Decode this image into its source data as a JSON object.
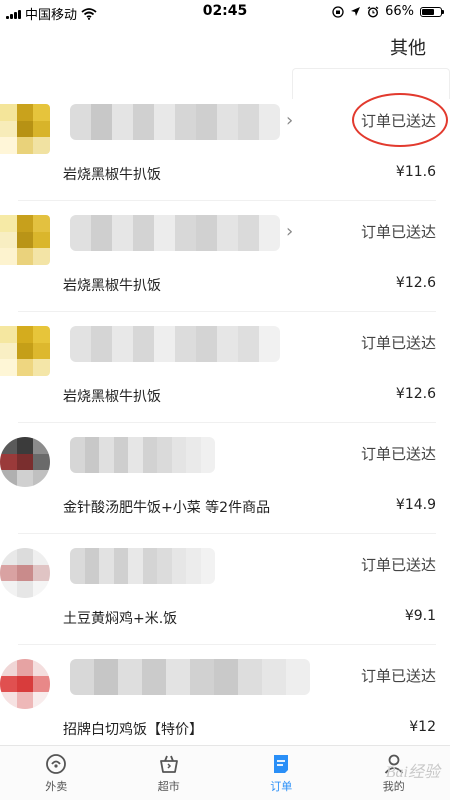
{
  "status_bar": {
    "carrier": "中国移动",
    "time": "02:45",
    "battery": "66%",
    "battery_level": 0.66
  },
  "header": {
    "other_label": "其他"
  },
  "orders": [
    {
      "status": "订单已送达",
      "item": "岩烧黑椒牛扒饭",
      "price": "¥11.6",
      "has_arrow": true,
      "highlighted": true
    },
    {
      "status": "订单已送达",
      "item": "岩烧黑椒牛扒饭",
      "price": "¥12.6",
      "has_arrow": true
    },
    {
      "status": "订单已送达",
      "item": "岩烧黑椒牛扒饭",
      "price": "¥12.6"
    },
    {
      "status": "订单已送达",
      "item": "金针酸汤肥牛饭+小菜 等2件商品",
      "price": "¥14.9"
    },
    {
      "status": "订单已送达",
      "item": "土豆黄焖鸡+米.饭",
      "price": "¥9.1"
    },
    {
      "status": "订单已送达",
      "item": "招牌白切鸡饭【特价】",
      "price": "¥12"
    }
  ],
  "tab_bar": {
    "tabs": [
      {
        "label": "外卖",
        "icon": "delivery-icon"
      },
      {
        "label": "超市",
        "icon": "basket-icon"
      },
      {
        "label": "订单",
        "icon": "order-icon",
        "active": true
      },
      {
        "label": "我的",
        "icon": "profile-icon"
      }
    ],
    "active_color": "#2a8ff7"
  },
  "colors": {
    "highlight_circle": "#e23a2e",
    "tab_active": "#2a8ff7"
  }
}
